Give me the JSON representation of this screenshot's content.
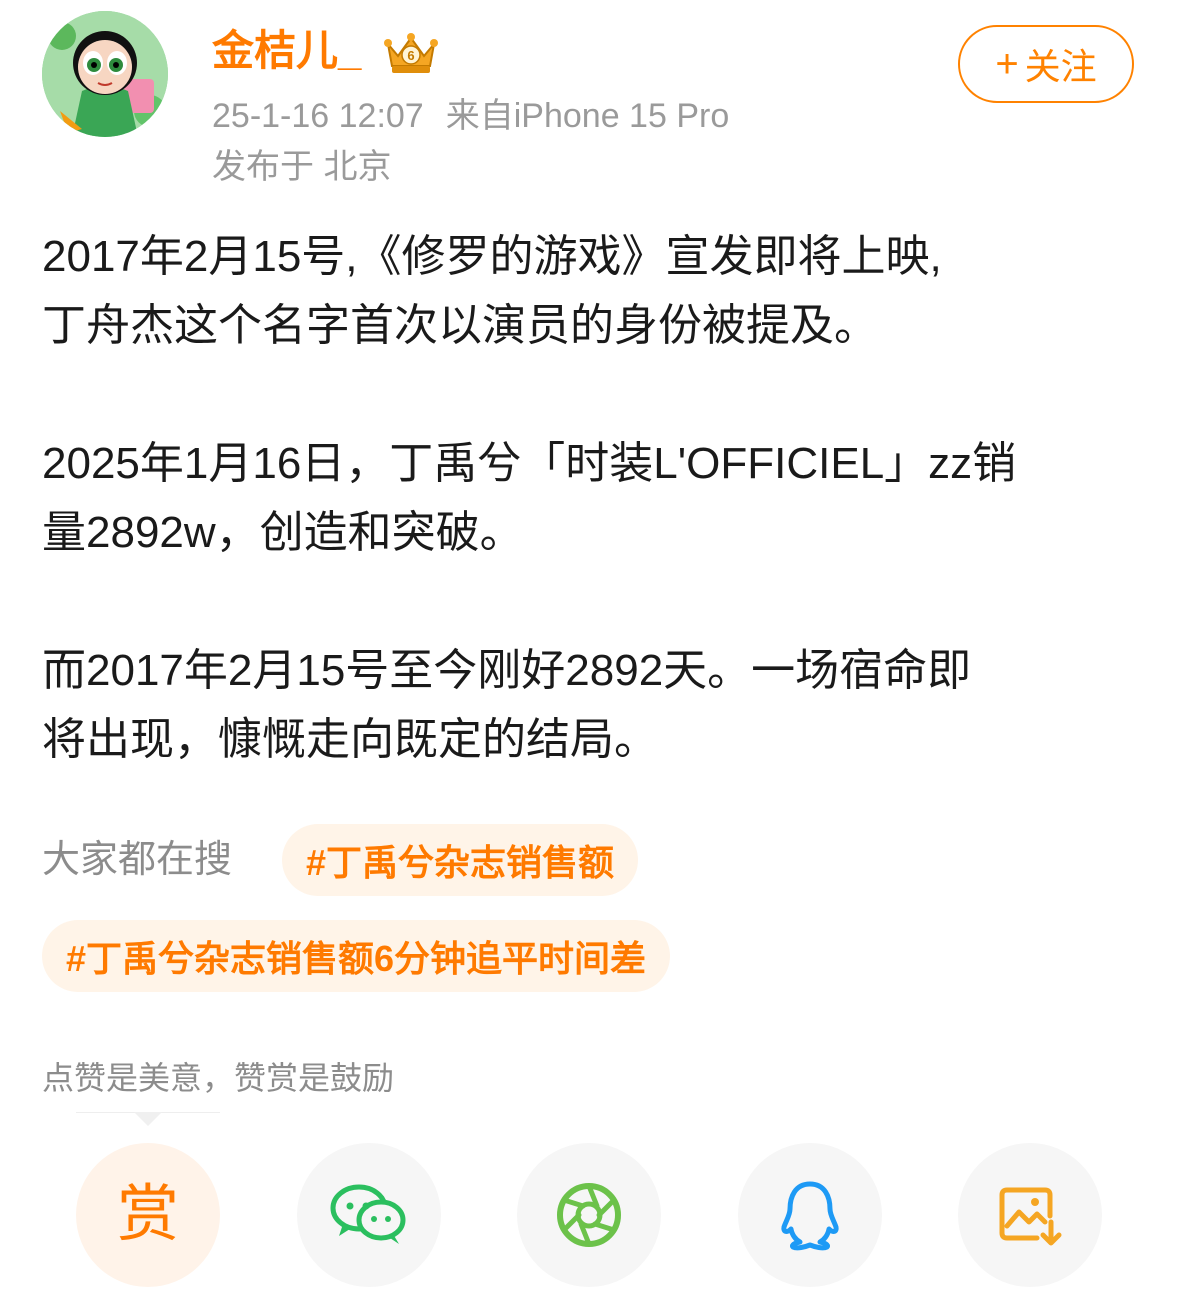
{
  "header": {
    "username": "金桔儿_",
    "timestamp": "25-1-16 12:07",
    "source": "来自iPhone 15 Pro",
    "location": "发布于 北京",
    "follow_label": "关注",
    "follow_plus": "+",
    "badge_level": "6"
  },
  "post": {
    "lines": [
      "2017年2月15号,《修罗的游戏》宣发即将上映,",
      "丁舟杰这个名字首次以演员的身份被提及。",
      "2025年1月16日，丁禹兮「时装L'OFFICIEL」zz销",
      "量2892w，创造和突破。",
      "而2017年2月15号至今刚好2892天。一场宿命即",
      "将出现，慷慨走向既定的结局。"
    ]
  },
  "search": {
    "label": "大家都在搜",
    "tags": [
      "#丁禹兮杂志销售额",
      "#丁禹兮杂志销售额6分钟追平时间差"
    ]
  },
  "reward": {
    "text": "点赞是美意，赞赏是鼓励",
    "button_label": "赏"
  },
  "share_buttons": [
    {
      "icon": "reward-icon"
    },
    {
      "icon": "wechat-icon"
    },
    {
      "icon": "moments-icon"
    },
    {
      "icon": "qq-icon"
    },
    {
      "icon": "save-image-icon"
    }
  ],
  "colors": {
    "accent": "#ff7a00",
    "meta_text": "#9a9a9a",
    "tag_bg": "#fff4e8"
  }
}
